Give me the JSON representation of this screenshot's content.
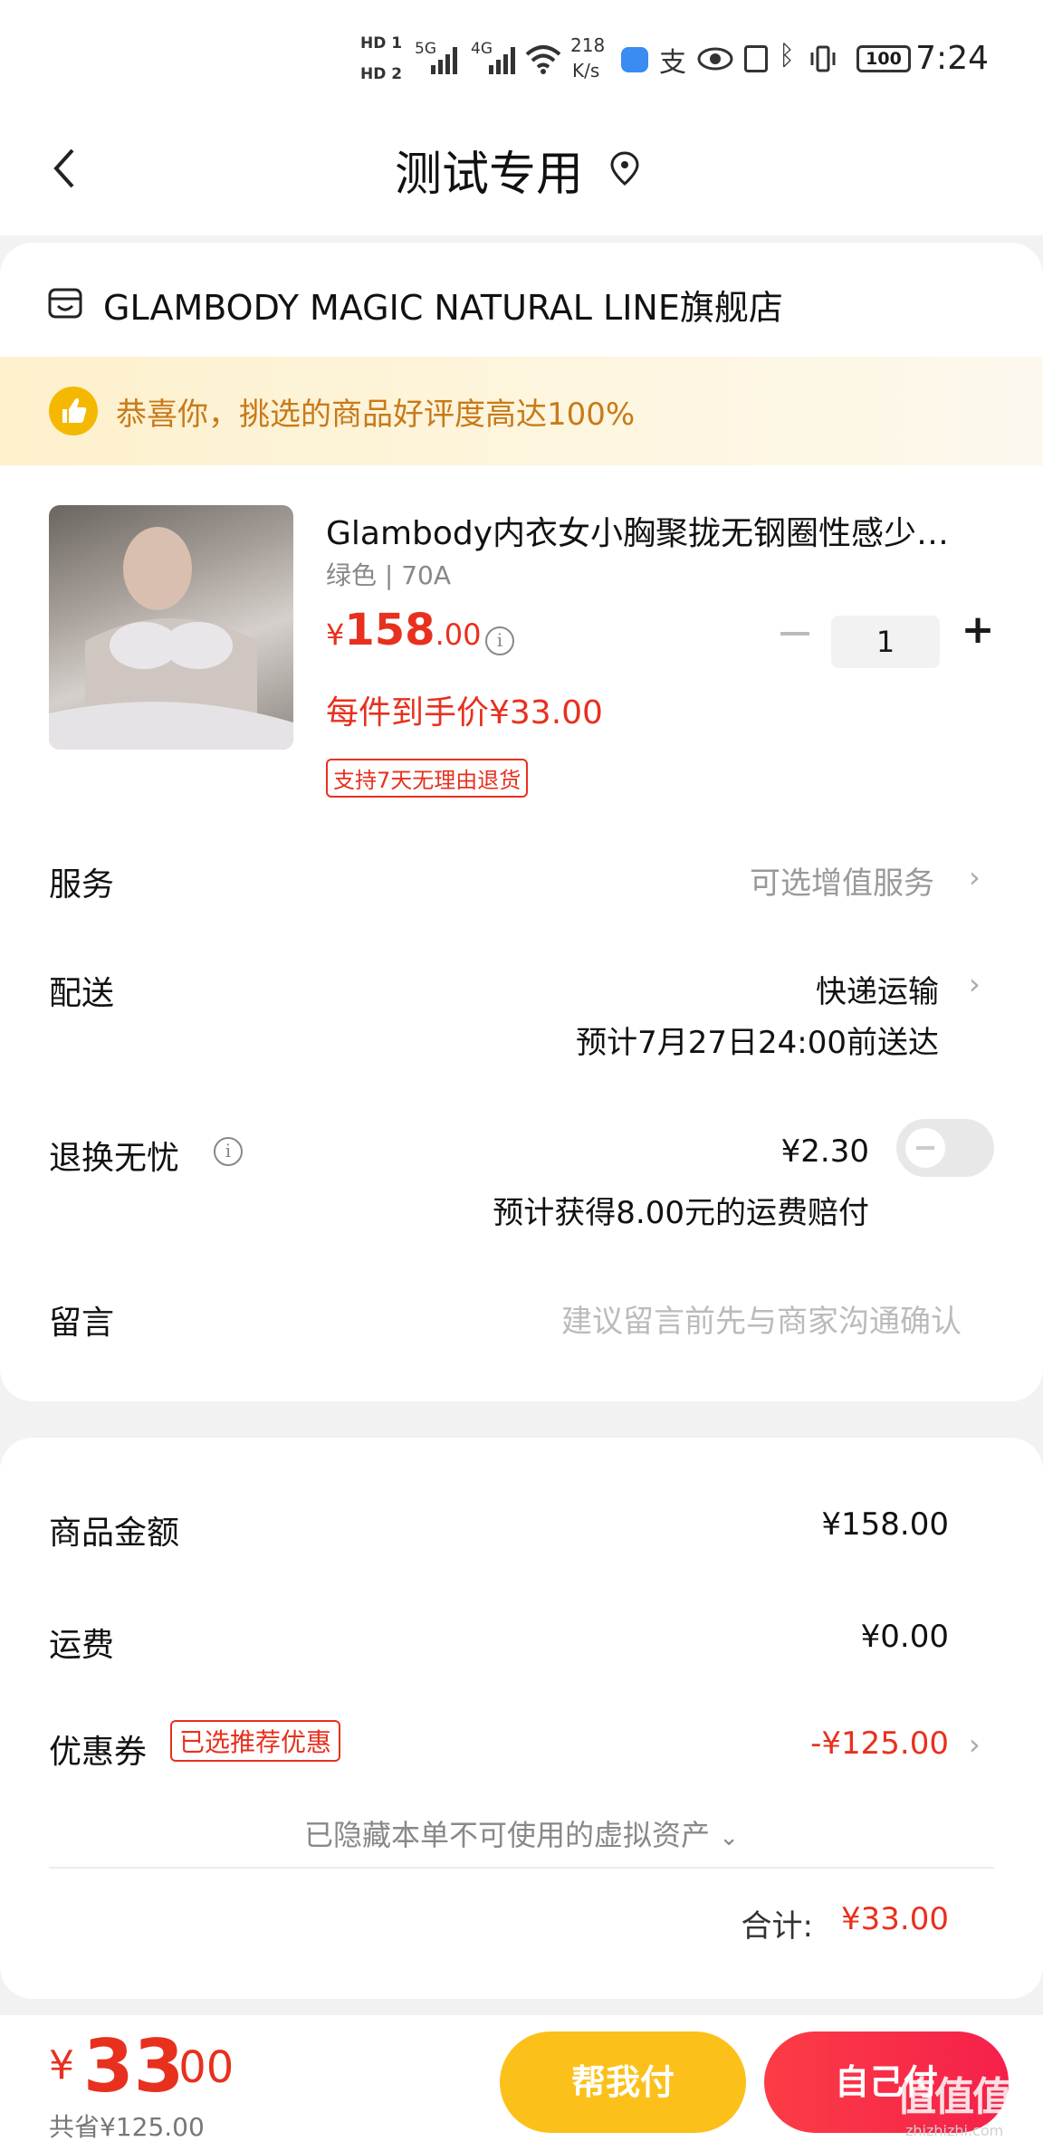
{
  "status_bar": {
    "sim1": "HD 1",
    "sim2": "HD 2",
    "net1": "5G",
    "net2": "4G",
    "speed": "218",
    "speed_unit": "K/s",
    "battery": "100",
    "time": "7:24"
  },
  "header": {
    "title": "测试专用"
  },
  "shop": {
    "name": "GLAMBODY MAGIC NATURAL LINE旗舰店"
  },
  "banner": {
    "text": "恭喜你，挑选的商品好评度高达100%"
  },
  "product": {
    "title": "Glambody内衣女小胸聚拢无钢圈性感少…",
    "spec": "绿色 | 70A",
    "price_yen": "¥",
    "price_int": "158",
    "price_dec": ".00",
    "unit_price": "每件到手价¥33.00",
    "return_tag": "支持7天无理由退货",
    "quantity": "1"
  },
  "rows": {
    "service_label": "服务",
    "service_value": "可选增值服务",
    "delivery_label": "配送",
    "delivery_value": "快递运输",
    "delivery_eta": "预计7月27日24:00前送达",
    "insurance_label": "退换无忧",
    "insurance_price": "¥2.30",
    "insurance_note": "预计获得8.00元的运费赔付",
    "insurance_enabled": false,
    "message_label": "留言",
    "message_placeholder": "建议留言前先与商家沟通确认"
  },
  "summary": {
    "goods_label": "商品金额",
    "goods_value": "¥158.00",
    "shipping_label": "运费",
    "shipping_value": "¥0.00",
    "coupon_label": "优惠券",
    "coupon_tag": "已选推荐优惠",
    "coupon_value": "-¥125.00",
    "hidden_assets": "已隐藏本单不可使用的虚拟资产",
    "total_label": "合计:",
    "total_value": "¥33.00"
  },
  "bottom": {
    "yen": "¥",
    "price_int": "33",
    "price_dec": ".00",
    "saved": "共省¥125.00",
    "help_pay": "帮我付",
    "self_pay": "自己付",
    "watermark": "值值值",
    "watermark_sub": "zhizhizhi.com"
  },
  "colors": {
    "accent_red": "#e8301e",
    "help_button": "#fcc01a",
    "self_button": "#f5204a",
    "banner_text": "#c87a1a"
  }
}
